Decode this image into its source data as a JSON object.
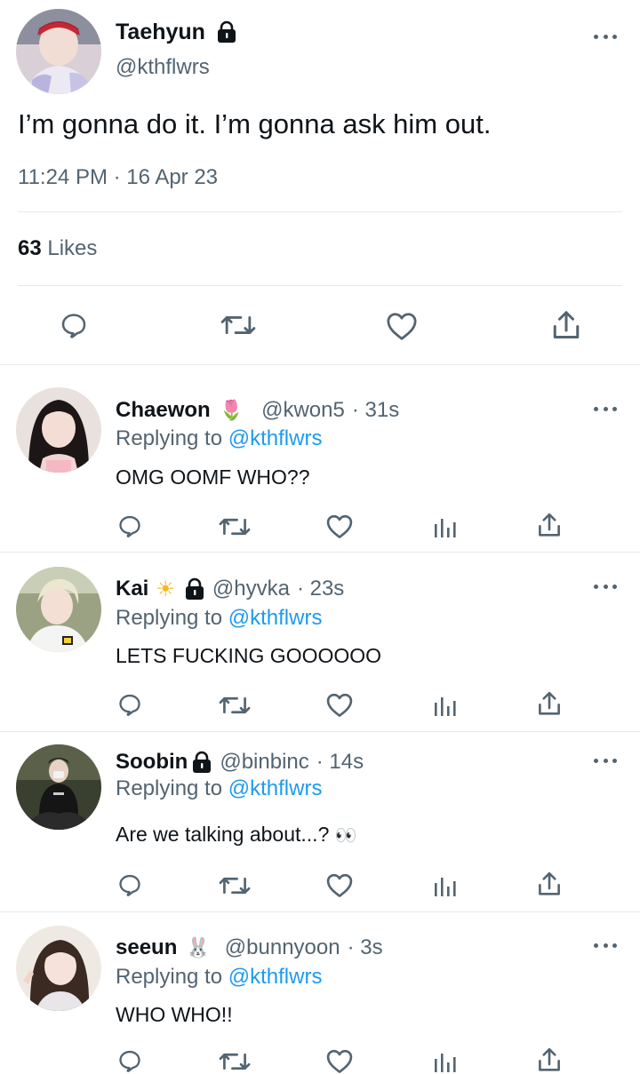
{
  "main_tweet": {
    "name": "Taehyun",
    "handle": "@kthflwrs",
    "text": "I’m gonna do it. I’m gonna ask him out.",
    "time": "11:24 PM · 16 Apr 23",
    "likes_count": "63",
    "likes_label": "Likes"
  },
  "replying_label": "Replying to",
  "replies": [
    {
      "name": "Chaewon",
      "emoji": "🌷",
      "handle": "@kwon5",
      "time": "· 31s",
      "replying_to": "@kthflwrs",
      "text": "OMG OOMF WHO??"
    },
    {
      "name": "Kai",
      "emoji": "☀",
      "handle": "@hyvka",
      "time": "· 23s",
      "replying_to": "@kthflwrs",
      "text": "LETS FUCKING GOOOOOO"
    },
    {
      "name": "Soobin",
      "handle": "@binbinc",
      "time": "· 14s",
      "replying_to": "@kthflwrs",
      "text": "Are we talking about...?",
      "text_emoji": "👀"
    },
    {
      "name": "seeun",
      "emoji": "🐰",
      "handle": "@bunnyoon",
      "time": "· 3s",
      "replying_to": "@kthflwrs",
      "text": "WHO WHO!!"
    }
  ],
  "colors": {
    "link": "#1d9bf0",
    "muted": "#536471",
    "text": "#0f1419"
  }
}
